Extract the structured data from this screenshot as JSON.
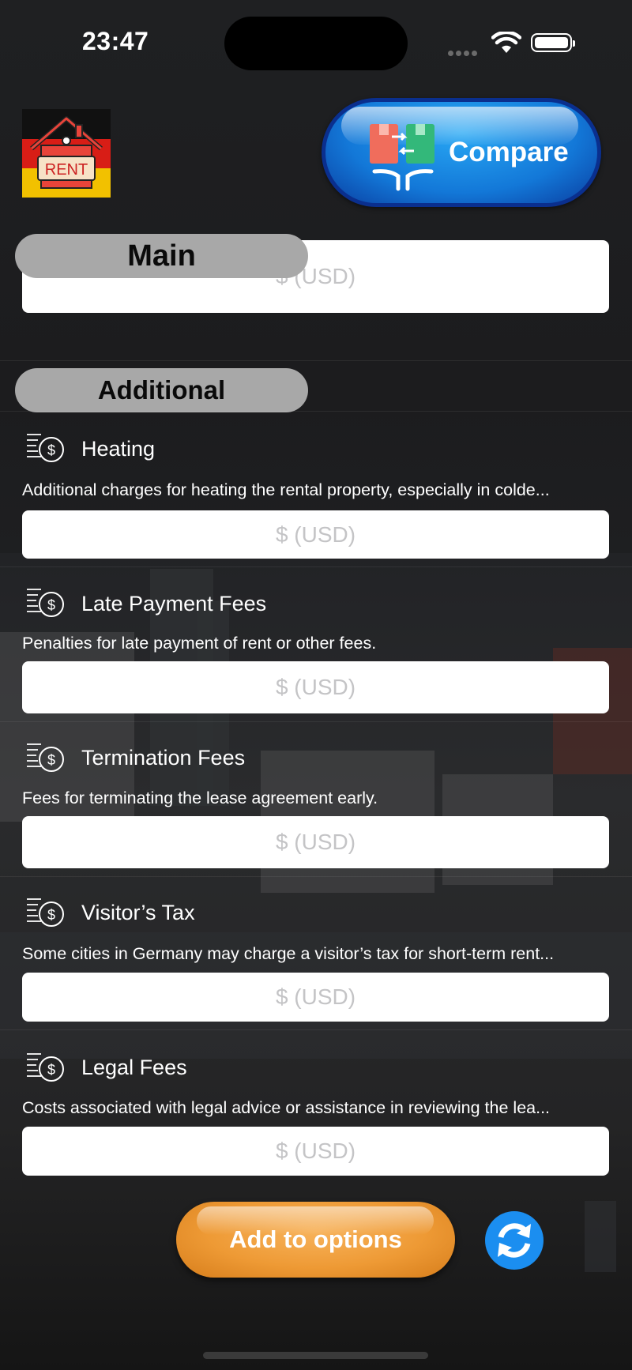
{
  "status_bar": {
    "time": "23:47"
  },
  "header": {
    "logo_text": "RENT",
    "compare_label": "Compare"
  },
  "main": {
    "title": "Main",
    "input_placeholder": "$ (USD)"
  },
  "additional": {
    "title": "Additional",
    "items": [
      {
        "title": "Heating",
        "description": "Additional charges for heating the rental property, especially in colde...",
        "placeholder": "$ (USD)"
      },
      {
        "title": "Late Payment Fees",
        "description": "Penalties for late payment of rent or other fees.",
        "placeholder": "$ (USD)"
      },
      {
        "title": "Termination Fees",
        "description": "Fees for terminating the lease agreement early.",
        "placeholder": "$ (USD)"
      },
      {
        "title": "Visitor’s Tax",
        "description": "Some cities in Germany may charge a visitor’s tax for short-term rent...",
        "placeholder": "$ (USD)"
      },
      {
        "title": "Legal Fees",
        "description": "Costs associated with legal advice or assistance in reviewing the lea...",
        "placeholder": "$ (USD)"
      }
    ]
  },
  "footer": {
    "add_label": "Add to options"
  },
  "icons": {
    "item_icon": "fee-list-dollar-icon",
    "refresh": "refresh-icon",
    "compare": "compare-boxes-icon",
    "logo": "rent-house-icon"
  },
  "colors": {
    "compare_blue": "#1378d8",
    "add_orange": "#ee9a35",
    "refresh_blue": "#1b8ef0",
    "pill_gray": "#a8a8a8"
  }
}
